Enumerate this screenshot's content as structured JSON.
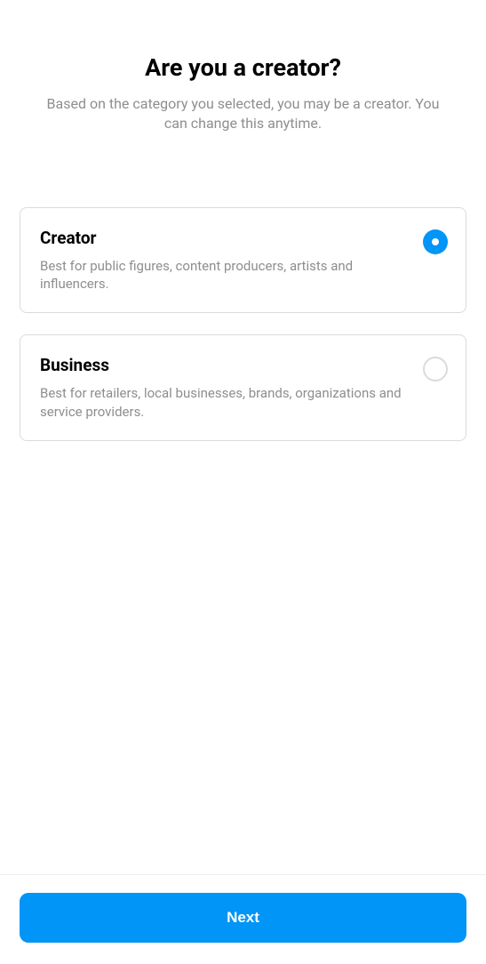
{
  "header": {
    "title": "Are you a creator?",
    "subtitle": "Based on the category you selected, you may be a creator. You can change this anytime."
  },
  "options": {
    "creator": {
      "title": "Creator",
      "description": "Best for public figures, content producers, artists and influencers.",
      "selected": true
    },
    "business": {
      "title": "Business",
      "description": "Best for retailers, local businesses, brands, organizations and service providers.",
      "selected": false
    }
  },
  "footer": {
    "next_label": "Next"
  }
}
